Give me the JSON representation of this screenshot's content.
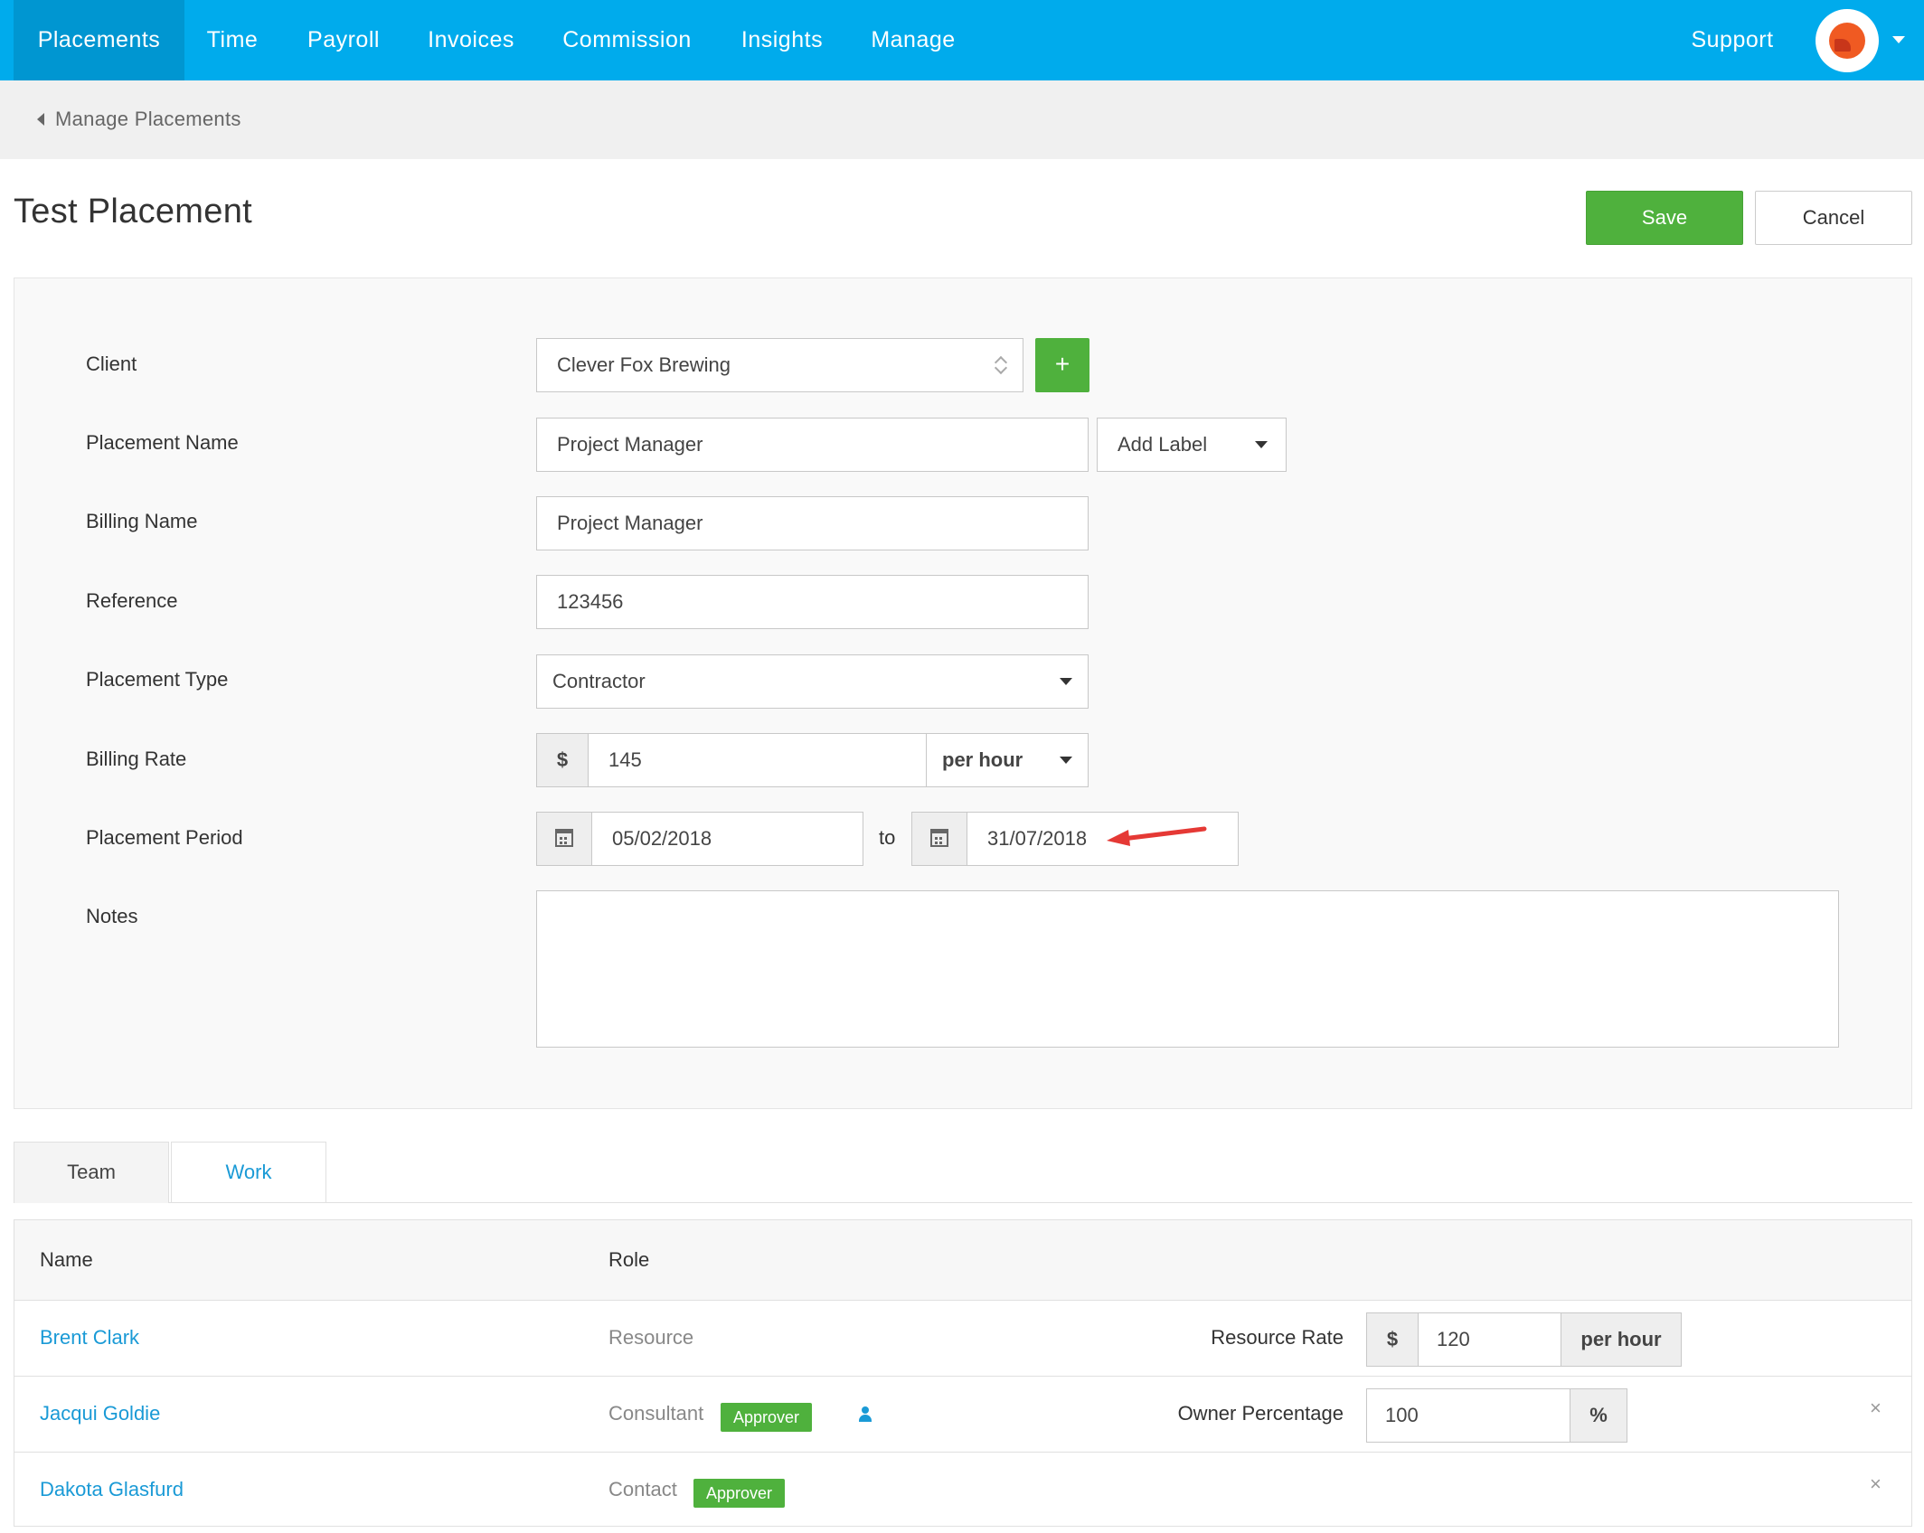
{
  "nav": {
    "items": [
      "Placements",
      "Time",
      "Payroll",
      "Invoices",
      "Commission",
      "Insights",
      "Manage"
    ],
    "support": "Support"
  },
  "breadcrumb": {
    "back_label": "Manage Placements"
  },
  "page": {
    "title": "Test Placement",
    "save_label": "Save",
    "cancel_label": "Cancel"
  },
  "form": {
    "client": {
      "label": "Client",
      "value": "Clever Fox Brewing",
      "add_button": "+"
    },
    "placement_name": {
      "label": "Placement Name",
      "value": "Project Manager",
      "add_label": "Add Label"
    },
    "billing_name": {
      "label": "Billing Name",
      "value": "Project Manager"
    },
    "reference": {
      "label": "Reference",
      "value": "123456"
    },
    "placement_type": {
      "label": "Placement Type",
      "value": "Contractor"
    },
    "billing_rate": {
      "label": "Billing Rate",
      "currency": "$",
      "value": "145",
      "unit": "per hour"
    },
    "placement_period": {
      "label": "Placement Period",
      "start": "05/02/2018",
      "separator": "to",
      "end": "31/07/2018"
    },
    "notes": {
      "label": "Notes",
      "value": ""
    }
  },
  "tabs": [
    "Team",
    "Work"
  ],
  "team_table": {
    "headers": [
      "Name",
      "Role"
    ],
    "rows": [
      {
        "name": "Brent Clark",
        "role": "Resource",
        "field_label": "Resource Rate",
        "currency": "$",
        "value": "120",
        "unit": "per hour"
      },
      {
        "name": "Jacqui Goldie",
        "role": "Consultant",
        "badge": "Approver",
        "field_label": "Owner Percentage",
        "value": "100",
        "unit": "%",
        "remove": "×"
      },
      {
        "name": "Dakota Glasfurd",
        "role": "Contact",
        "badge": "Approver",
        "remove": "×"
      }
    ]
  },
  "colors": {
    "nav_bg": "#00abec",
    "nav_active": "#0096d1",
    "primary_green": "#4fb13d",
    "link_blue": "#1a9ad6",
    "annotation_red": "#e53935"
  }
}
